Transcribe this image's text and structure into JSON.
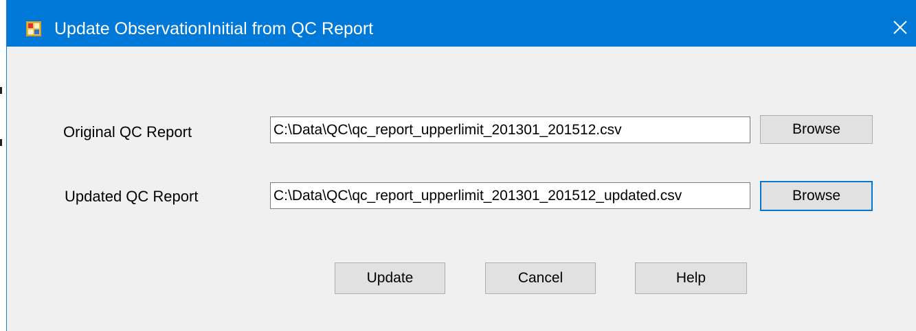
{
  "window": {
    "title": "Update ObservationInitial from QC Report"
  },
  "form": {
    "original_label": "Original QC Report",
    "original_path": "C:\\Data\\QC\\qc_report_upperlimit_201301_201512.csv",
    "updated_label": "Updated QC Report",
    "updated_path": "C:\\Data\\QC\\qc_report_upperlimit_201301_201512_updated.csv",
    "browse_label": "Browse"
  },
  "actions": {
    "update_label": "Update",
    "cancel_label": "Cancel",
    "help_label": "Help"
  },
  "colors": {
    "titlebar": "#0078d7",
    "dialog_background": "#f0f0f0",
    "focus_border": "#0078d7"
  },
  "icons": {
    "app": "form-window-icon",
    "close": "close-icon"
  }
}
